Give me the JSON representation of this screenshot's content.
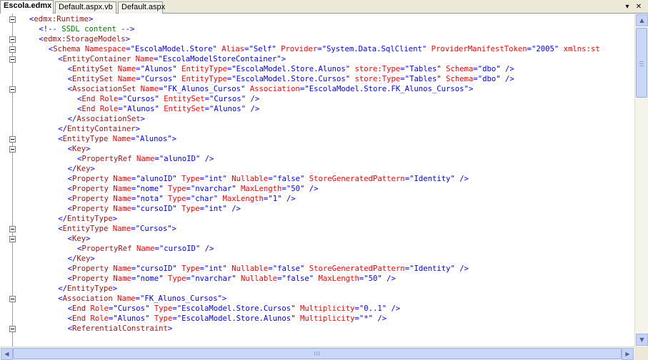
{
  "tabs": [
    {
      "label": "Escola.edmx",
      "active": true
    },
    {
      "label": "Default.aspx.vb",
      "active": false
    },
    {
      "label": "Default.aspx",
      "active": false
    }
  ],
  "tab_controls": {
    "dropdown": "▾",
    "close": "✕"
  },
  "icons": {
    "fold": "collapse-icon",
    "scroll_up": "▲",
    "scroll_down": "▼",
    "scroll_left": "◀",
    "scroll_right": "▶"
  },
  "colors": {
    "delimiter": "#0000ff",
    "element": "#a31515",
    "attribute": "#ff0000",
    "value": "#0000ff",
    "comment": "#008000"
  },
  "lines": [
    {
      "indent": 0,
      "fold": true,
      "tokens": [
        [
          "d",
          "<"
        ],
        [
          "e",
          "edmx:Runtime"
        ],
        [
          "d",
          ">"
        ]
      ]
    },
    {
      "indent": 1,
      "fold": false,
      "tokens": [
        [
          "d",
          "<!--"
        ],
        [
          "c",
          " SSDL content "
        ],
        [
          "d",
          "-->"
        ]
      ]
    },
    {
      "indent": 1,
      "fold": true,
      "tokens": [
        [
          "d",
          "<"
        ],
        [
          "e",
          "edmx:StorageModels"
        ],
        [
          "d",
          ">"
        ]
      ]
    },
    {
      "indent": 2,
      "fold": true,
      "tokens": [
        [
          "d",
          "<"
        ],
        [
          "e",
          "Schema"
        ],
        [
          "a",
          " Namespace"
        ],
        [
          "d",
          "=\""
        ],
        [
          "v",
          "EscolaModel.Store"
        ],
        [
          "d",
          "\""
        ],
        [
          "a",
          " Alias"
        ],
        [
          "d",
          "=\""
        ],
        [
          "v",
          "Self"
        ],
        [
          "d",
          "\""
        ],
        [
          "a",
          " Provider"
        ],
        [
          "d",
          "=\""
        ],
        [
          "v",
          "System.Data.SqlClient"
        ],
        [
          "d",
          "\""
        ],
        [
          "a",
          " ProviderManifestToken"
        ],
        [
          "d",
          "=\""
        ],
        [
          "v",
          "2005"
        ],
        [
          "d",
          "\""
        ],
        [
          "a",
          " xmlns:st"
        ]
      ]
    },
    {
      "indent": 3,
      "fold": true,
      "tokens": [
        [
          "d",
          "<"
        ],
        [
          "e",
          "EntityContainer"
        ],
        [
          "a",
          " Name"
        ],
        [
          "d",
          "=\""
        ],
        [
          "v",
          "EscolaModelStoreContainer"
        ],
        [
          "d",
          "\">"
        ]
      ]
    },
    {
      "indent": 4,
      "fold": false,
      "tokens": [
        [
          "d",
          "<"
        ],
        [
          "e",
          "EntitySet"
        ],
        [
          "a",
          " Name"
        ],
        [
          "d",
          "=\""
        ],
        [
          "v",
          "Alunos"
        ],
        [
          "d",
          "\""
        ],
        [
          "a",
          " EntityType"
        ],
        [
          "d",
          "=\""
        ],
        [
          "v",
          "EscolaModel.Store.Alunos"
        ],
        [
          "d",
          "\""
        ],
        [
          "a",
          " store:Type"
        ],
        [
          "d",
          "=\""
        ],
        [
          "v",
          "Tables"
        ],
        [
          "d",
          "\""
        ],
        [
          "a",
          " Schema"
        ],
        [
          "d",
          "=\""
        ],
        [
          "v",
          "dbo"
        ],
        [
          "d",
          "\" />"
        ]
      ]
    },
    {
      "indent": 4,
      "fold": false,
      "tokens": [
        [
          "d",
          "<"
        ],
        [
          "e",
          "EntitySet"
        ],
        [
          "a",
          " Name"
        ],
        [
          "d",
          "=\""
        ],
        [
          "v",
          "Cursos"
        ],
        [
          "d",
          "\""
        ],
        [
          "a",
          " EntityType"
        ],
        [
          "d",
          "=\""
        ],
        [
          "v",
          "EscolaModel.Store.Cursos"
        ],
        [
          "d",
          "\""
        ],
        [
          "a",
          " store:Type"
        ],
        [
          "d",
          "=\""
        ],
        [
          "v",
          "Tables"
        ],
        [
          "d",
          "\""
        ],
        [
          "a",
          " Schema"
        ],
        [
          "d",
          "=\""
        ],
        [
          "v",
          "dbo"
        ],
        [
          "d",
          "\" />"
        ]
      ]
    },
    {
      "indent": 4,
      "fold": true,
      "tokens": [
        [
          "d",
          "<"
        ],
        [
          "e",
          "AssociationSet"
        ],
        [
          "a",
          " Name"
        ],
        [
          "d",
          "=\""
        ],
        [
          "v",
          "FK_Alunos_Cursos"
        ],
        [
          "d",
          "\""
        ],
        [
          "a",
          " Association"
        ],
        [
          "d",
          "=\""
        ],
        [
          "v",
          "EscolaModel.Store.FK_Alunos_Cursos"
        ],
        [
          "d",
          "\">"
        ]
      ]
    },
    {
      "indent": 5,
      "fold": false,
      "tokens": [
        [
          "d",
          "<"
        ],
        [
          "e",
          "End"
        ],
        [
          "a",
          " Role"
        ],
        [
          "d",
          "=\""
        ],
        [
          "v",
          "Cursos"
        ],
        [
          "d",
          "\""
        ],
        [
          "a",
          " EntitySet"
        ],
        [
          "d",
          "=\""
        ],
        [
          "v",
          "Cursos"
        ],
        [
          "d",
          "\" />"
        ]
      ]
    },
    {
      "indent": 5,
      "fold": false,
      "tokens": [
        [
          "d",
          "<"
        ],
        [
          "e",
          "End"
        ],
        [
          "a",
          " Role"
        ],
        [
          "d",
          "=\""
        ],
        [
          "v",
          "Alunos"
        ],
        [
          "d",
          "\""
        ],
        [
          "a",
          " EntitySet"
        ],
        [
          "d",
          "=\""
        ],
        [
          "v",
          "Alunos"
        ],
        [
          "d",
          "\" />"
        ]
      ]
    },
    {
      "indent": 4,
      "fold": false,
      "tokens": [
        [
          "d",
          "</"
        ],
        [
          "e",
          "AssociationSet"
        ],
        [
          "d",
          ">"
        ]
      ]
    },
    {
      "indent": 3,
      "fold": false,
      "tokens": [
        [
          "d",
          "</"
        ],
        [
          "e",
          "EntityContainer"
        ],
        [
          "d",
          ">"
        ]
      ]
    },
    {
      "indent": 3,
      "fold": true,
      "tokens": [
        [
          "d",
          "<"
        ],
        [
          "e",
          "EntityType"
        ],
        [
          "a",
          " Name"
        ],
        [
          "d",
          "=\""
        ],
        [
          "v",
          "Alunos"
        ],
        [
          "d",
          "\">"
        ]
      ]
    },
    {
      "indent": 4,
      "fold": true,
      "tokens": [
        [
          "d",
          "<"
        ],
        [
          "e",
          "Key"
        ],
        [
          "d",
          ">"
        ]
      ]
    },
    {
      "indent": 5,
      "fold": false,
      "tokens": [
        [
          "d",
          "<"
        ],
        [
          "e",
          "PropertyRef"
        ],
        [
          "a",
          " Name"
        ],
        [
          "d",
          "=\""
        ],
        [
          "v",
          "alunoID"
        ],
        [
          "d",
          "\" />"
        ]
      ]
    },
    {
      "indent": 4,
      "fold": false,
      "tokens": [
        [
          "d",
          "</"
        ],
        [
          "e",
          "Key"
        ],
        [
          "d",
          ">"
        ]
      ]
    },
    {
      "indent": 4,
      "fold": false,
      "tokens": [
        [
          "d",
          "<"
        ],
        [
          "e",
          "Property"
        ],
        [
          "a",
          " Name"
        ],
        [
          "d",
          "=\""
        ],
        [
          "v",
          "alunoID"
        ],
        [
          "d",
          "\""
        ],
        [
          "a",
          " Type"
        ],
        [
          "d",
          "=\""
        ],
        [
          "v",
          "int"
        ],
        [
          "d",
          "\""
        ],
        [
          "a",
          " Nullable"
        ],
        [
          "d",
          "=\""
        ],
        [
          "v",
          "false"
        ],
        [
          "d",
          "\""
        ],
        [
          "a",
          " StoreGeneratedPattern"
        ],
        [
          "d",
          "=\""
        ],
        [
          "v",
          "Identity"
        ],
        [
          "d",
          "\" />"
        ]
      ]
    },
    {
      "indent": 4,
      "fold": false,
      "tokens": [
        [
          "d",
          "<"
        ],
        [
          "e",
          "Property"
        ],
        [
          "a",
          " Name"
        ],
        [
          "d",
          "=\""
        ],
        [
          "v",
          "nome"
        ],
        [
          "d",
          "\""
        ],
        [
          "a",
          " Type"
        ],
        [
          "d",
          "=\""
        ],
        [
          "v",
          "nvarchar"
        ],
        [
          "d",
          "\""
        ],
        [
          "a",
          " MaxLength"
        ],
        [
          "d",
          "=\""
        ],
        [
          "v",
          "50"
        ],
        [
          "d",
          "\" />"
        ]
      ]
    },
    {
      "indent": 4,
      "fold": false,
      "tokens": [
        [
          "d",
          "<"
        ],
        [
          "e",
          "Property"
        ],
        [
          "a",
          " Name"
        ],
        [
          "d",
          "=\""
        ],
        [
          "v",
          "nota"
        ],
        [
          "d",
          "\""
        ],
        [
          "a",
          " Type"
        ],
        [
          "d",
          "=\""
        ],
        [
          "v",
          "char"
        ],
        [
          "d",
          "\""
        ],
        [
          "a",
          " MaxLength"
        ],
        [
          "d",
          "=\""
        ],
        [
          "v",
          "1"
        ],
        [
          "d",
          "\" />"
        ]
      ]
    },
    {
      "indent": 4,
      "fold": false,
      "tokens": [
        [
          "d",
          "<"
        ],
        [
          "e",
          "Property"
        ],
        [
          "a",
          " Name"
        ],
        [
          "d",
          "=\""
        ],
        [
          "v",
          "cursoID"
        ],
        [
          "d",
          "\""
        ],
        [
          "a",
          " Type"
        ],
        [
          "d",
          "=\""
        ],
        [
          "v",
          "int"
        ],
        [
          "d",
          "\" />"
        ]
      ]
    },
    {
      "indent": 3,
      "fold": false,
      "tokens": [
        [
          "d",
          "</"
        ],
        [
          "e",
          "EntityType"
        ],
        [
          "d",
          ">"
        ]
      ]
    },
    {
      "indent": 3,
      "fold": true,
      "tokens": [
        [
          "d",
          "<"
        ],
        [
          "e",
          "EntityType"
        ],
        [
          "a",
          " Name"
        ],
        [
          "d",
          "=\""
        ],
        [
          "v",
          "Cursos"
        ],
        [
          "d",
          "\">"
        ]
      ]
    },
    {
      "indent": 4,
      "fold": true,
      "tokens": [
        [
          "d",
          "<"
        ],
        [
          "e",
          "Key"
        ],
        [
          "d",
          ">"
        ]
      ]
    },
    {
      "indent": 5,
      "fold": false,
      "tokens": [
        [
          "d",
          "<"
        ],
        [
          "e",
          "PropertyRef"
        ],
        [
          "a",
          " Name"
        ],
        [
          "d",
          "=\""
        ],
        [
          "v",
          "cursoID"
        ],
        [
          "d",
          "\" />"
        ]
      ]
    },
    {
      "indent": 4,
      "fold": false,
      "tokens": [
        [
          "d",
          "</"
        ],
        [
          "e",
          "Key"
        ],
        [
          "d",
          ">"
        ]
      ]
    },
    {
      "indent": 4,
      "fold": false,
      "tokens": [
        [
          "d",
          "<"
        ],
        [
          "e",
          "Property"
        ],
        [
          "a",
          " Name"
        ],
        [
          "d",
          "=\""
        ],
        [
          "v",
          "cursoID"
        ],
        [
          "d",
          "\""
        ],
        [
          "a",
          " Type"
        ],
        [
          "d",
          "=\""
        ],
        [
          "v",
          "int"
        ],
        [
          "d",
          "\""
        ],
        [
          "a",
          " Nullable"
        ],
        [
          "d",
          "=\""
        ],
        [
          "v",
          "false"
        ],
        [
          "d",
          "\""
        ],
        [
          "a",
          " StoreGeneratedPattern"
        ],
        [
          "d",
          "=\""
        ],
        [
          "v",
          "Identity"
        ],
        [
          "d",
          "\" />"
        ]
      ]
    },
    {
      "indent": 4,
      "fold": false,
      "tokens": [
        [
          "d",
          "<"
        ],
        [
          "e",
          "Property"
        ],
        [
          "a",
          " Name"
        ],
        [
          "d",
          "=\""
        ],
        [
          "v",
          "nome"
        ],
        [
          "d",
          "\""
        ],
        [
          "a",
          " Type"
        ],
        [
          "d",
          "=\""
        ],
        [
          "v",
          "nvarchar"
        ],
        [
          "d",
          "\""
        ],
        [
          "a",
          " Nullable"
        ],
        [
          "d",
          "=\""
        ],
        [
          "v",
          "false"
        ],
        [
          "d",
          "\""
        ],
        [
          "a",
          " MaxLength"
        ],
        [
          "d",
          "=\""
        ],
        [
          "v",
          "50"
        ],
        [
          "d",
          "\" />"
        ]
      ]
    },
    {
      "indent": 3,
      "fold": false,
      "tokens": [
        [
          "d",
          "</"
        ],
        [
          "e",
          "EntityType"
        ],
        [
          "d",
          ">"
        ]
      ]
    },
    {
      "indent": 3,
      "fold": true,
      "tokens": [
        [
          "d",
          "<"
        ],
        [
          "e",
          "Association"
        ],
        [
          "a",
          " Name"
        ],
        [
          "d",
          "=\""
        ],
        [
          "v",
          "FK_Alunos_Cursos"
        ],
        [
          "d",
          "\">"
        ]
      ]
    },
    {
      "indent": 4,
      "fold": false,
      "tokens": [
        [
          "d",
          "<"
        ],
        [
          "e",
          "End"
        ],
        [
          "a",
          " Role"
        ],
        [
          "d",
          "=\""
        ],
        [
          "v",
          "Cursos"
        ],
        [
          "d",
          "\""
        ],
        [
          "a",
          " Type"
        ],
        [
          "d",
          "=\""
        ],
        [
          "v",
          "EscolaModel.Store.Cursos"
        ],
        [
          "d",
          "\""
        ],
        [
          "a",
          " Multiplicity"
        ],
        [
          "d",
          "=\""
        ],
        [
          "v",
          "0..1"
        ],
        [
          "d",
          "\" />"
        ]
      ]
    },
    {
      "indent": 4,
      "fold": false,
      "tokens": [
        [
          "d",
          "<"
        ],
        [
          "e",
          "End"
        ],
        [
          "a",
          " Role"
        ],
        [
          "d",
          "=\""
        ],
        [
          "v",
          "Alunos"
        ],
        [
          "d",
          "\""
        ],
        [
          "a",
          " Type"
        ],
        [
          "d",
          "=\""
        ],
        [
          "v",
          "EscolaModel.Store.Alunos"
        ],
        [
          "d",
          "\""
        ],
        [
          "a",
          " Multiplicity"
        ],
        [
          "d",
          "=\""
        ],
        [
          "v",
          "*"
        ],
        [
          "d",
          "\" />"
        ]
      ]
    },
    {
      "indent": 4,
      "fold": true,
      "tokens": [
        [
          "d",
          "<"
        ],
        [
          "e",
          "ReferentialConstraint"
        ],
        [
          "d",
          ">"
        ]
      ]
    }
  ]
}
